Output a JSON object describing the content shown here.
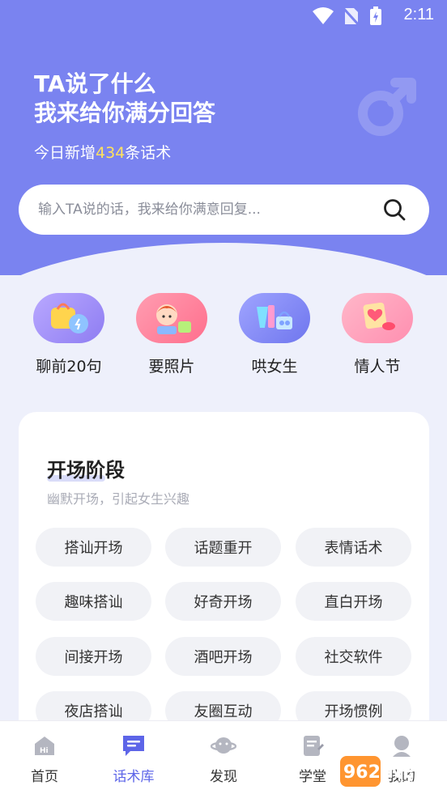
{
  "status_bar": {
    "time": "2:11"
  },
  "hero": {
    "title_line1": "TA说了什么",
    "title_line2": "我来给你满分回答",
    "subtitle_prefix": "今日新增",
    "subtitle_count": "434",
    "subtitle_suffix": "条话术",
    "highlight_color": "#ffe25e",
    "background_color": "#7a83f0"
  },
  "search": {
    "placeholder": "输入TA说的话，我来给你满意回复..."
  },
  "categories": [
    {
      "label": "聊前20句",
      "icon": "chat-bag-icon"
    },
    {
      "label": "要照片",
      "icon": "girl-photo-icon"
    },
    {
      "label": "哄女生",
      "icon": "gifts-icon"
    },
    {
      "label": "情人节",
      "icon": "valentine-card-icon"
    }
  ],
  "stage_card": {
    "title": "开场阶段",
    "subtitle": "幽默开场，引起女生兴趣",
    "tags": [
      "搭讪开场",
      "话题重开",
      "表情话术",
      "趣味搭讪",
      "好奇开场",
      "直白开场",
      "间接开场",
      "酒吧开场",
      "社交软件",
      "夜店搭讪",
      "友圈互动",
      "开场惯例"
    ]
  },
  "tabbar": {
    "active_color": "#5d65e8",
    "items": [
      {
        "label": "首页",
        "icon": "home-hi-icon"
      },
      {
        "label": "话术库",
        "icon": "chat-library-icon",
        "active": true
      },
      {
        "label": "发现",
        "icon": "planet-icon"
      },
      {
        "label": "学堂",
        "icon": "notebook-icon"
      },
      {
        "label": "我的",
        "icon": "profile-icon"
      }
    ]
  },
  "watermark": {
    "text": "962.NET",
    "sub": "乐游网"
  }
}
